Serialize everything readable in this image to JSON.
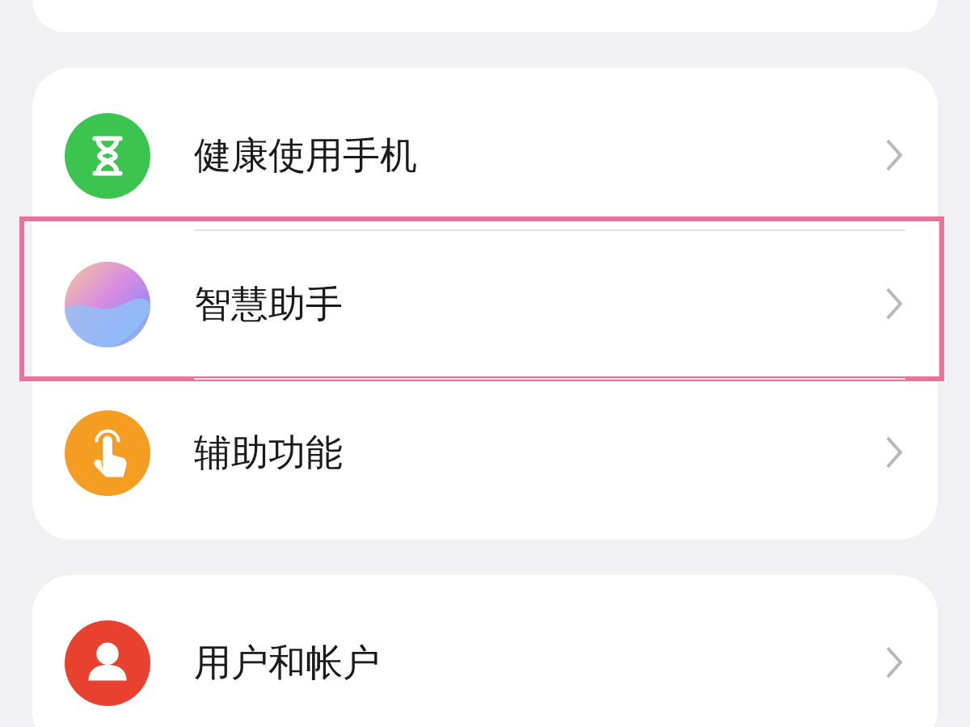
{
  "sections": [
    {
      "items": [
        {
          "kind": "hourglass",
          "label": "健康使用手机",
          "highlighted": false
        },
        {
          "kind": "orb",
          "label": "智慧助手",
          "highlighted": true
        },
        {
          "kind": "hand",
          "label": "辅助功能",
          "highlighted": false
        }
      ]
    },
    {
      "items": [
        {
          "kind": "person",
          "label": "用户和帐户",
          "highlighted": false
        }
      ]
    }
  ]
}
